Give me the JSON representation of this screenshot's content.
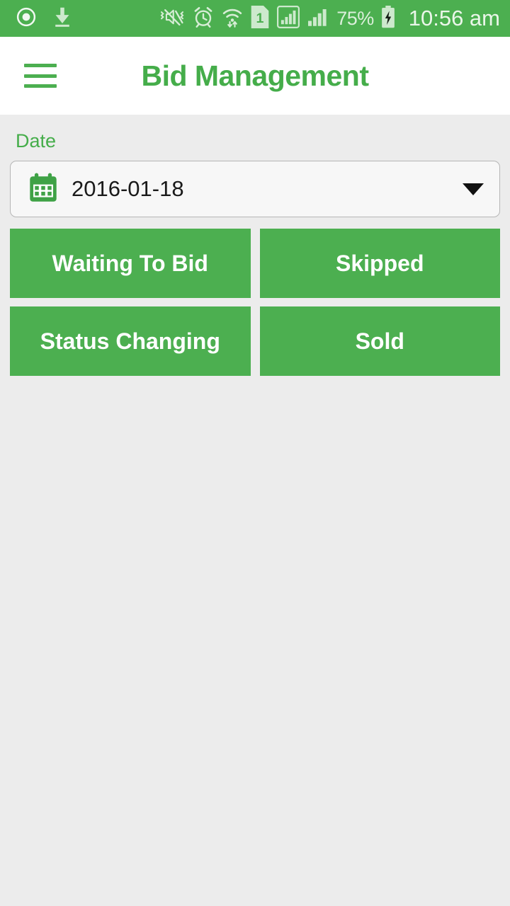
{
  "status_bar": {
    "background_color": "#4caf50",
    "left_icons": [
      {
        "name": "screen-recorder-icon",
        "label": "screen-recorder"
      },
      {
        "name": "download-icon",
        "label": "download"
      }
    ],
    "right_icons": [
      {
        "name": "vibrate-mute-icon",
        "label": "sound-off-vibrate"
      },
      {
        "name": "alarm-clock-icon",
        "label": "alarm"
      },
      {
        "name": "wifi-transfer-icon",
        "label": "wifi-data-transfer"
      },
      {
        "name": "sim-card-1-icon",
        "label": "1"
      },
      {
        "name": "signal-roaming-icon",
        "label": "signal-boxed"
      },
      {
        "name": "signal-bars-icon",
        "label": "signal"
      }
    ],
    "battery_percent": "75%",
    "battery_state": "charging",
    "time": "10:56 am"
  },
  "app_bar": {
    "menu_icon": "hamburger-menu-icon",
    "title": "Bid Management",
    "title_color": "#45ad4a",
    "background_color": "#ffffff"
  },
  "form": {
    "date_label": "Date",
    "date_value": "2016-01-18",
    "date_icon": "calendar-icon",
    "dropdown_icon": "caret-down-icon"
  },
  "actions": {
    "button_color": "#4caf50",
    "buttons": [
      {
        "label": "Waiting To Bid",
        "name": "waiting-to-bid-button"
      },
      {
        "label": "Skipped",
        "name": "skipped-button"
      },
      {
        "label": "Status Changing",
        "name": "status-changing-button"
      },
      {
        "label": "Sold",
        "name": "sold-button"
      }
    ]
  },
  "page": {
    "background_color": "#ececec"
  }
}
